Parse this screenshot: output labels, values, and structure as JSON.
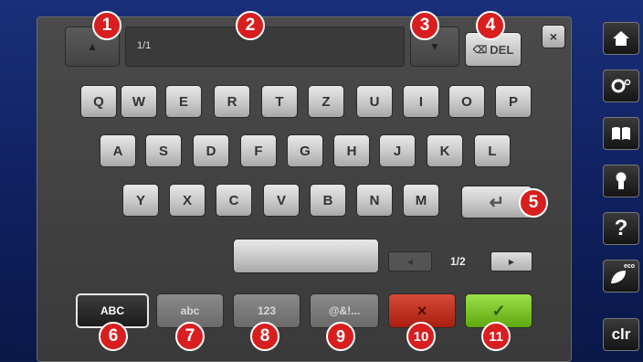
{
  "text_field": {
    "page_indicator": "1/1"
  },
  "delete_button": {
    "label": "DEL"
  },
  "close_button": {
    "icon": "×"
  },
  "keyboard": {
    "row1": [
      "Q",
      "W",
      "E",
      "R",
      "T",
      "Z",
      "U",
      "I",
      "O",
      "P"
    ],
    "row2": [
      "A",
      "S",
      "D",
      "F",
      "G",
      "H",
      "J",
      "K",
      "L"
    ],
    "row3": [
      "Y",
      "X",
      "C",
      "V",
      "B",
      "N",
      "M"
    ]
  },
  "pager": {
    "value": "1/2"
  },
  "mode_buttons": {
    "upper": "ABC",
    "lower": "abc",
    "numbers": "123",
    "symbols": "@&!..."
  },
  "cancel_button": {
    "icon": "×"
  },
  "confirm_button": {
    "icon": "✓"
  },
  "sidebar": {
    "clr_label": "clr",
    "help_label": "?",
    "eco_label": "eco"
  },
  "callouts": [
    "1",
    "2",
    "3",
    "4",
    "5",
    "6",
    "7",
    "8",
    "9",
    "10",
    "11"
  ],
  "colors": {
    "badge": "#d81e1e",
    "cancel": "#c8281a",
    "confirm": "#7cc21e",
    "screen": "#1a2f7a"
  }
}
